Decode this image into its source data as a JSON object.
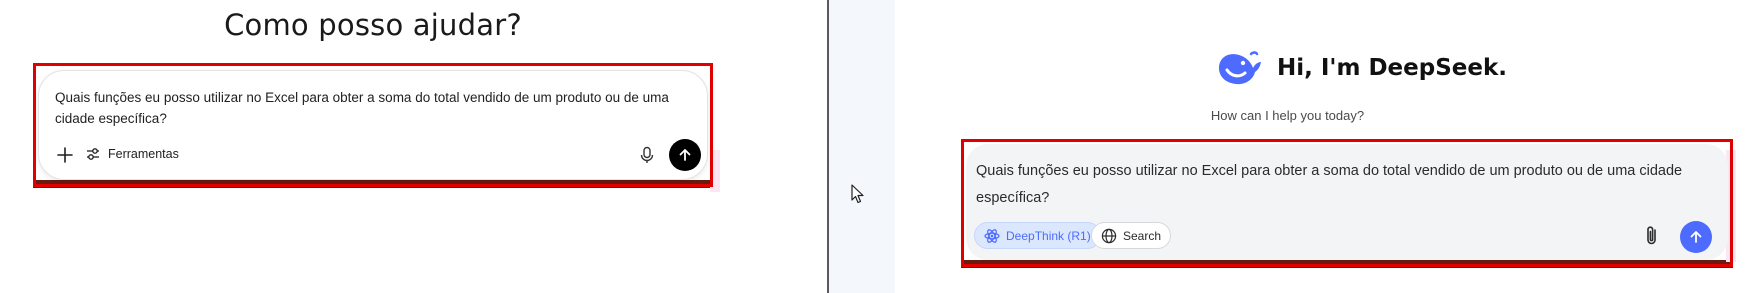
{
  "left_app": {
    "title": "Como posso ajudar?",
    "prompt_text": "Quais funções eu posso utilizar no Excel para obter a soma do total vendido de um produto ou de uma cidade específica?",
    "tools_label": "Ferramentas",
    "icons": {
      "add": "plus-icon",
      "tools": "sliders-icon",
      "mic": "microphone-icon",
      "send": "arrow-up-icon"
    },
    "colors": {
      "send_button": "#000000",
      "highlight": "#e00000"
    }
  },
  "right_app": {
    "greeting": "Hi, I'm DeepSeek.",
    "subtitle": "How can I help you today?",
    "prompt_text": "Quais funções eu posso utilizar no Excel para obter a soma do total vendido de um produto ou de uma cidade específica?",
    "chips": {
      "deepthink": "DeepThink (R1)",
      "search": "Search"
    },
    "icons": {
      "logo": "deepseek-whale-logo",
      "deepthink": "atom-icon",
      "search": "globe-icon",
      "attach": "paperclip-icon",
      "send": "arrow-up-icon"
    },
    "colors": {
      "brand": "#4d6bfe",
      "deepthink_chip_bg": "#dbe7fe",
      "highlight": "#e00000"
    }
  }
}
